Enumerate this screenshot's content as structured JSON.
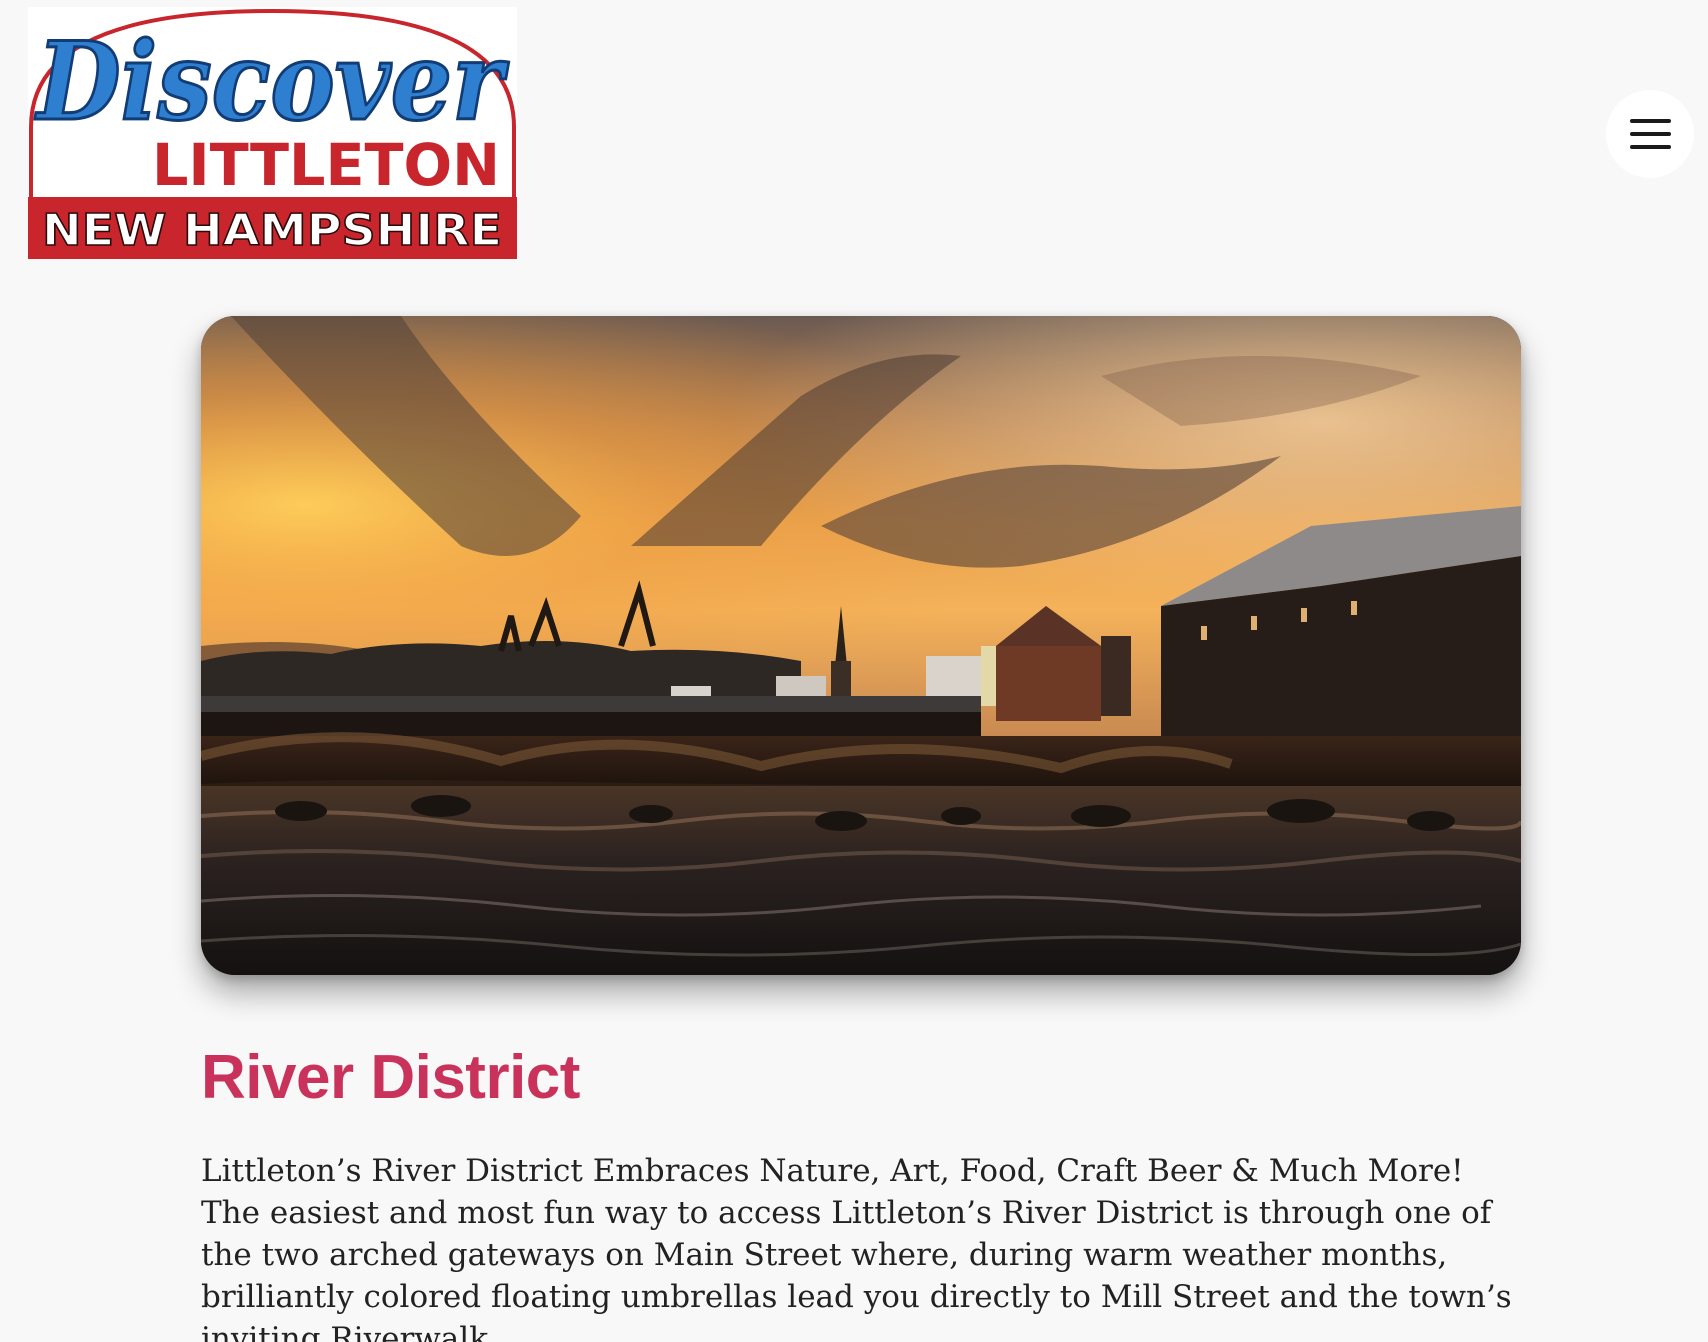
{
  "logo": {
    "script_text": "Discover",
    "town_text": "LITTLETON",
    "state_text": "NEW HAMPSHIRE",
    "colors": {
      "script_blue": "#2f7fd0",
      "brand_red": "#c8262c",
      "white": "#ffffff"
    }
  },
  "header": {
    "menu_icon": "hamburger-menu-icon"
  },
  "hero": {
    "image_description_icon": "river-district-sunset-photo"
  },
  "article": {
    "title": "River District",
    "body": "Littleton’s River District Embraces Nature, Art, Food, Craft Beer & Much More! The easiest and most fun way to access Littleton’s River District is through one of the two arched gateways on Main Street where, during warm weather months, brilliantly colored floating umbrellas lead you directly to Mill Street and the town’s inviting Riverwalk."
  },
  "colors": {
    "background": "#f8f8f8",
    "title": "#c9335b",
    "body_text": "#222222"
  }
}
